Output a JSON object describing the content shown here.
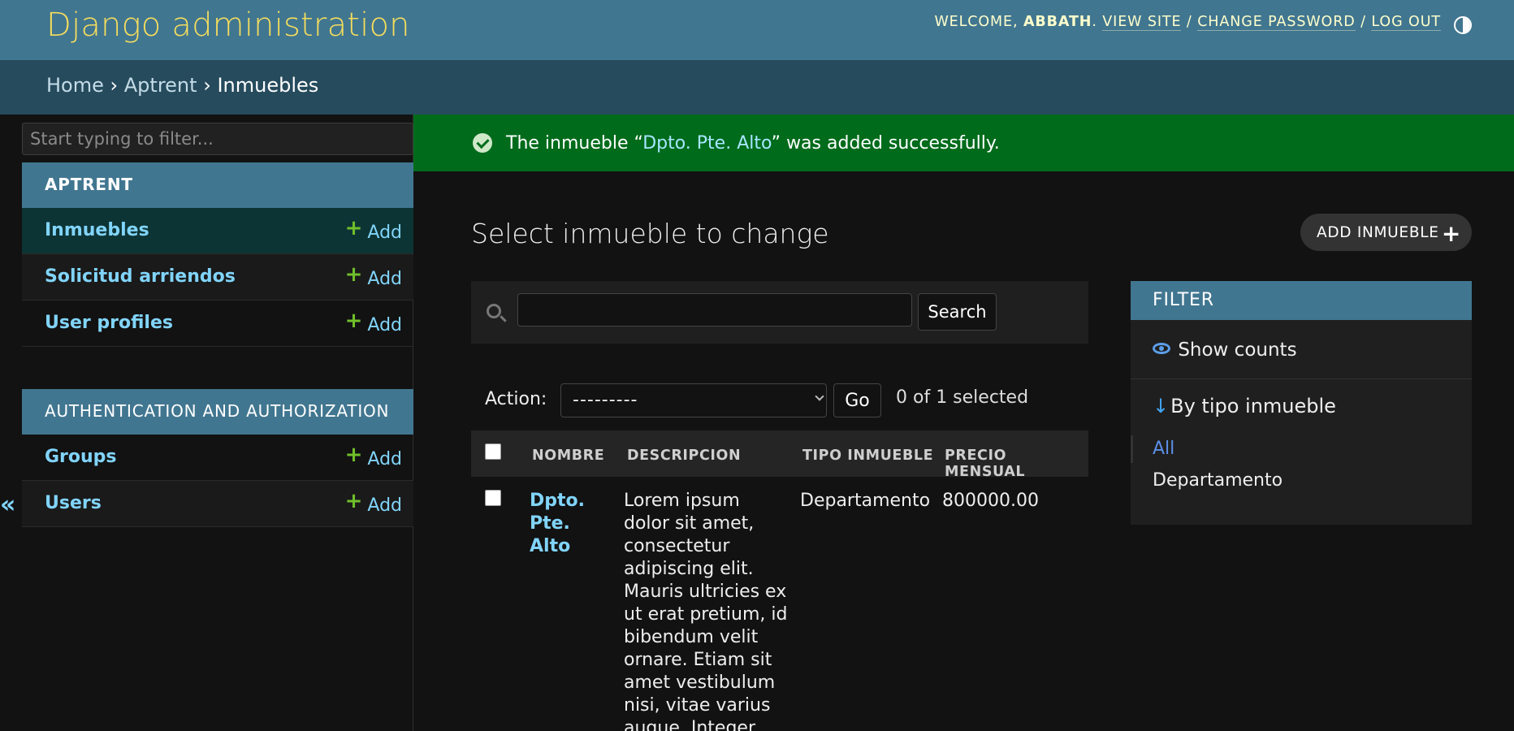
{
  "header": {
    "brand": "Django administration",
    "welcome": "WELCOME, ",
    "username": "ABBATH",
    "view_site": "VIEW SITE",
    "change_password": "CHANGE PASSWORD",
    "log_out": "LOG OUT",
    "separator": "/"
  },
  "breadcrumbs": {
    "home": "Home",
    "app": "Aptrent",
    "model": "Inmuebles",
    "sep": "›"
  },
  "sidebar": {
    "filter_placeholder": "Start typing to filter...",
    "apps": [
      {
        "caption": "APTRENT",
        "models": [
          {
            "label": "Inmuebles",
            "add": "Add"
          },
          {
            "label": "Solicitud arriendos",
            "add": "Add"
          },
          {
            "label": "User profiles",
            "add": "Add"
          }
        ]
      },
      {
        "caption": "AUTHENTICATION AND AUTHORIZATION",
        "models": [
          {
            "label": "Groups",
            "add": "Add"
          },
          {
            "label": "Users",
            "add": "Add"
          }
        ]
      }
    ],
    "collapse_label": "«"
  },
  "message": {
    "prefix": "The inmueble “",
    "object": "Dpto. Pte. Alto",
    "suffix": "” was added successfully."
  },
  "main": {
    "title": "Select inmueble to change",
    "add_button": "ADD INMUEBLE",
    "search_button": "Search",
    "search_value": "",
    "action_label": "Action:",
    "action_selected": "---------",
    "go_button": "Go",
    "selected_count": "0 of 1 selected",
    "columns": [
      "NOMBRE",
      "DESCRIPCION",
      "TIPO INMUEBLE",
      "PRECIO MENSUAL"
    ],
    "rows": [
      {
        "nombre_lines": [
          "Dpto.",
          "Pte.",
          "Alto"
        ],
        "descripcion_lines": [
          "Lorem ipsum",
          "dolor sit amet,",
          "consectetur",
          "adipiscing elit.",
          "Mauris ultricies ex",
          "ut erat pretium, id",
          "bibendum velit",
          "ornare. Etiam sit",
          "amet vestibulum",
          "nisi, vitae varius",
          "augue. Integer"
        ],
        "tipo": "Departamento",
        "precio": "800000.00"
      }
    ]
  },
  "filter": {
    "title": "FILTER",
    "show_counts": "Show counts",
    "by_label": "By tipo inmueble",
    "arrow": "↓",
    "options": [
      "All",
      "Departamento"
    ]
  },
  "colors": {
    "header": "#417690",
    "breadcrumbs": "#264b5d",
    "brand": "#f5dd5d",
    "link": "#81d4fa",
    "success": "#006b1b",
    "add_plus": "#70bf2b",
    "background": "#121212"
  },
  "icons": [
    "theme-toggle-icon",
    "success-check-icon",
    "search-icon",
    "add-plus-icon",
    "eye-icon",
    "sort-down-arrow-icon"
  ]
}
